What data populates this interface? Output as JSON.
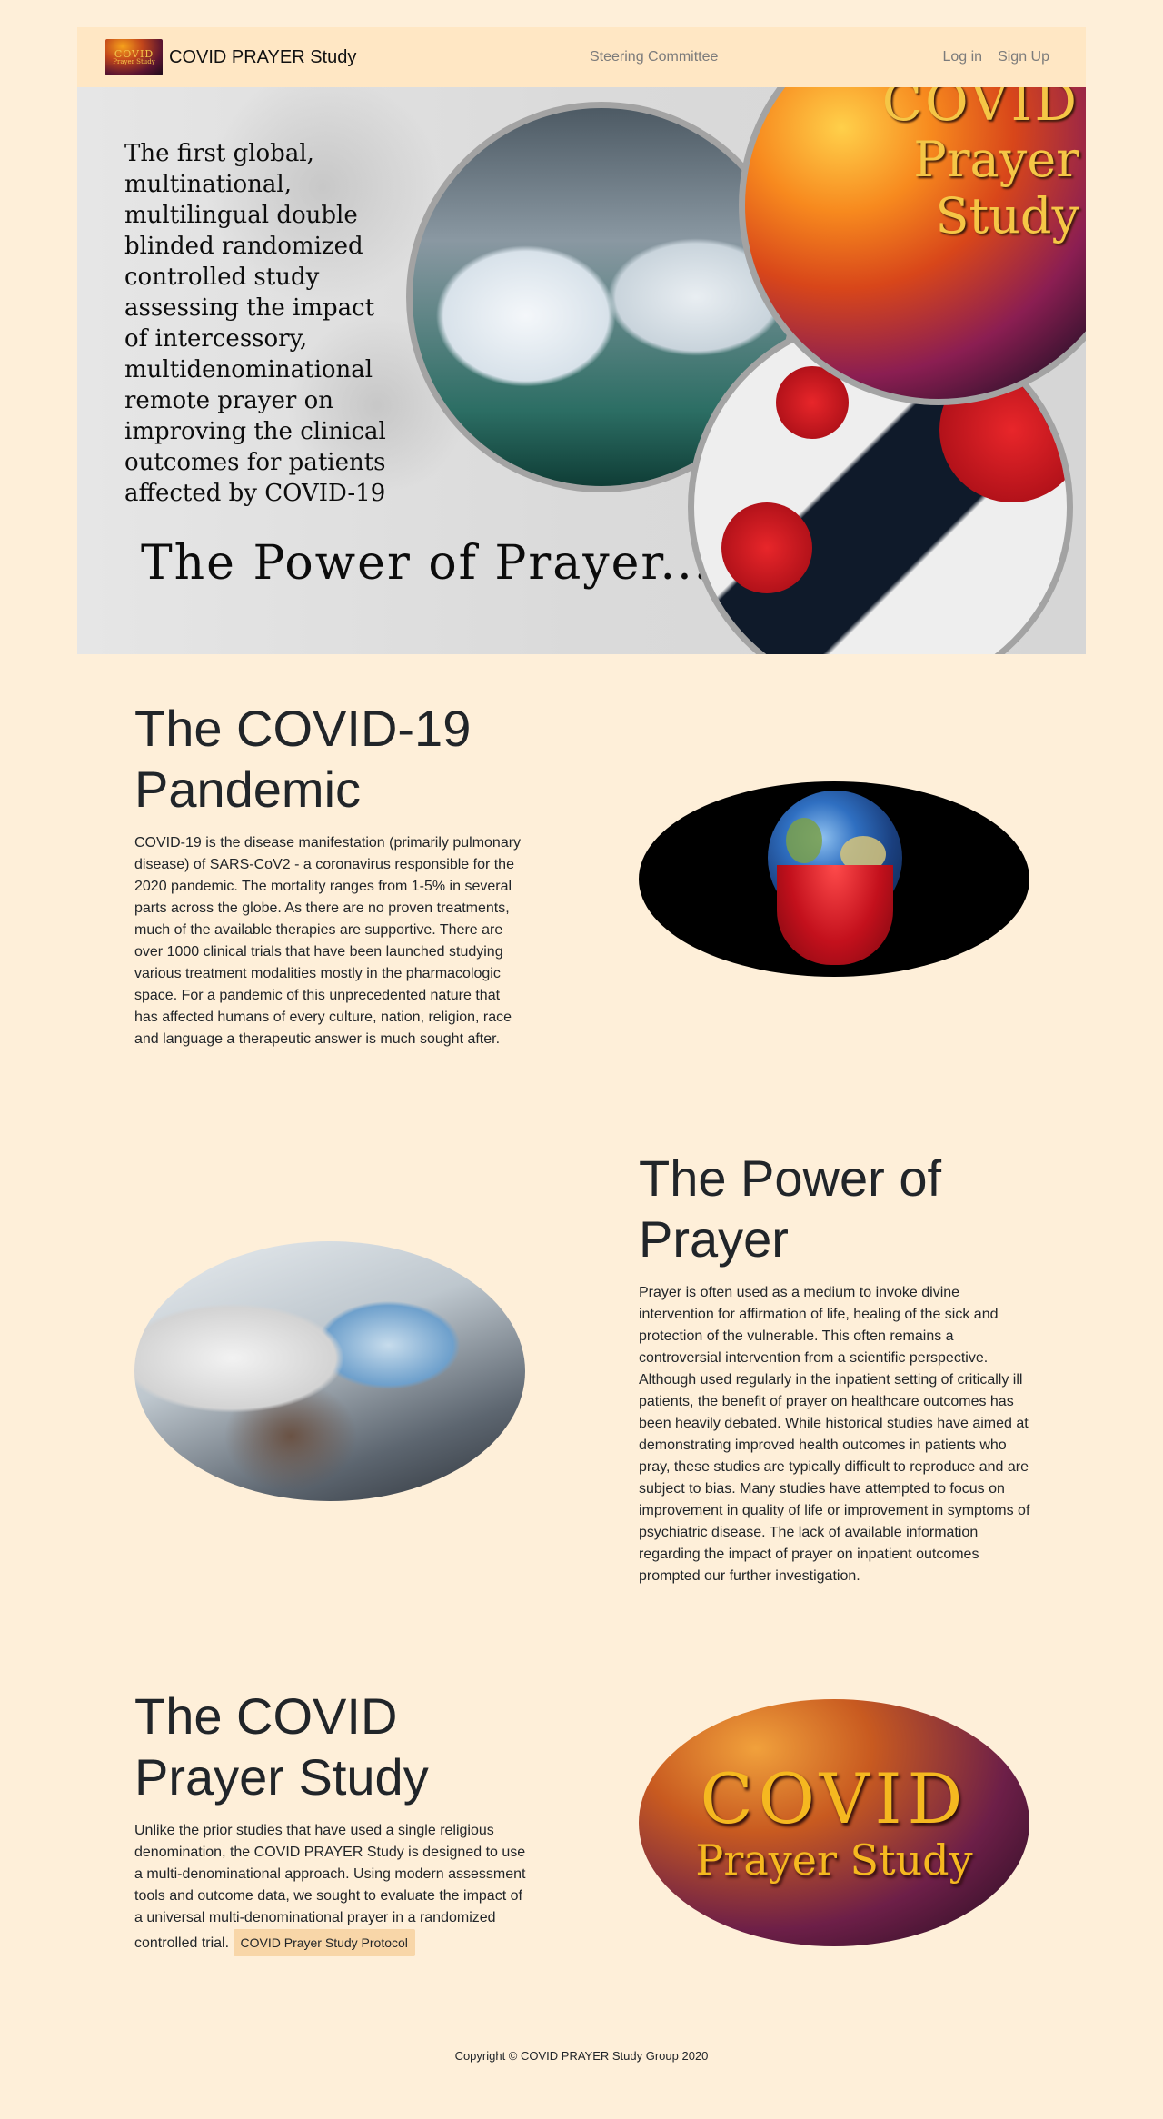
{
  "navbar": {
    "logo_line1": "COVID",
    "logo_line2": "Prayer Study",
    "brand": "COVID PRAYER Study",
    "center_link": "Steering Committee",
    "login": "Log in",
    "signup": "Sign Up"
  },
  "hero": {
    "description": "The first global, multinational, multilingual double blinded randomized controlled study assessing the impact of intercessory, multidenominational remote prayer on improving the clinical outcomes for patients affected by COVID-19",
    "tagline": "The Power of Prayer...",
    "title_line1": "COVID",
    "title_line2": "Prayer",
    "title_line3": "Study"
  },
  "sections": [
    {
      "title": "The COVID-19 Pandemic",
      "body": "COVID-19 is the disease manifestation (primarily pulmonary disease) of SARS-CoV2 - a coronavirus responsible for the 2020 pandemic. The mortality ranges from 1-5% in several parts across the globe. As there are no proven treatments, much of the available therapies are supportive. There are over 1000 clinical trials that have been launched studying various treatment modalities mostly in the pharmacologic space. For a pandemic of this unprecedented nature that has affected humans of every culture, nation, religion, race and language a therapeutic answer is much sought after."
    },
    {
      "title": "The Power of Prayer",
      "body": "Prayer is often used as a medium to invoke divine intervention for affirmation of life, healing of the sick and protection of the vulnerable. This often remains a controversial intervention from a scientific perspective. Although used regularly in the inpatient setting of critically ill patients, the benefit of prayer on healthcare outcomes has been heavily debated. While historical studies have aimed at demonstrating improved health outcomes in patients who pray, these studies are typically difficult to reproduce and are subject to bias. Many studies have attempted to focus on improvement in quality of life or improvement in symptoms of psychiatric disease. The lack of available information regarding the impact of prayer on inpatient outcomes prompted our further investigation."
    },
    {
      "title": "The COVID Prayer Study",
      "body": "Unlike the prior studies that have used a single religious denomination, the COVID PRAYER Study is designed to use a multi-denominational approach. Using modern assessment tools and outcome data, we sought to evaluate the impact of a universal multi-denominational prayer in a randomized controlled trial.",
      "button": "COVID Prayer Study Protocol"
    }
  ],
  "oval3": {
    "line1": "COVID",
    "line2": "Prayer Study"
  },
  "footer": "Copyright © COVID PRAYER Study Group 2020"
}
